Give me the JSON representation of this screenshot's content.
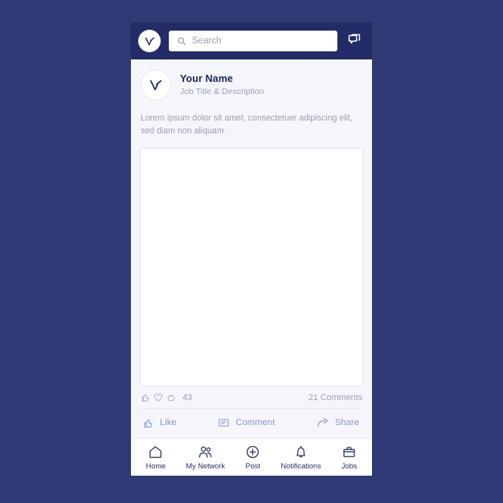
{
  "theme": {
    "page_background": "#2e3a73",
    "header_background": "#232c66",
    "card_background": "#f4f6fc",
    "accent_text": "#1d2657",
    "muted_text": "#9b9fb3",
    "action_text": "#8d93d6",
    "nav_text": "#2b3563"
  },
  "header": {
    "logo_icon": "brand-arrow-icon",
    "search": {
      "icon": "search-icon",
      "placeholder": "Search",
      "value": ""
    },
    "messages_icon": "messages-icon"
  },
  "post": {
    "avatar_icon": "brand-arrow-icon",
    "name": "Your Name",
    "subtitle": "Job Title & Description",
    "body": "Lorem ipsum dolor sit amet, consectetuer adipiscing elit, sed diam non aliquam.",
    "media_placeholder": "post-image-placeholder",
    "reactions": {
      "icons": [
        "thumbs-up-icon",
        "heart-icon",
        "clap-icon"
      ],
      "count": "43"
    },
    "comments_label": "21 Comments",
    "actions": [
      {
        "label": "Like",
        "icon": "thumbs-up-icon"
      },
      {
        "label": "Comment",
        "icon": "comment-bubble-icon"
      },
      {
        "label": "Share",
        "icon": "share-arrow-icon"
      }
    ]
  },
  "bottom_nav": {
    "items": [
      {
        "label": "Home",
        "icon": "home-icon"
      },
      {
        "label": "My Network",
        "icon": "network-people-icon"
      },
      {
        "label": "Post",
        "icon": "plus-circle-icon"
      },
      {
        "label": "Notifications",
        "icon": "bell-icon"
      },
      {
        "label": "Jobs",
        "icon": "briefcase-icon"
      }
    ]
  }
}
